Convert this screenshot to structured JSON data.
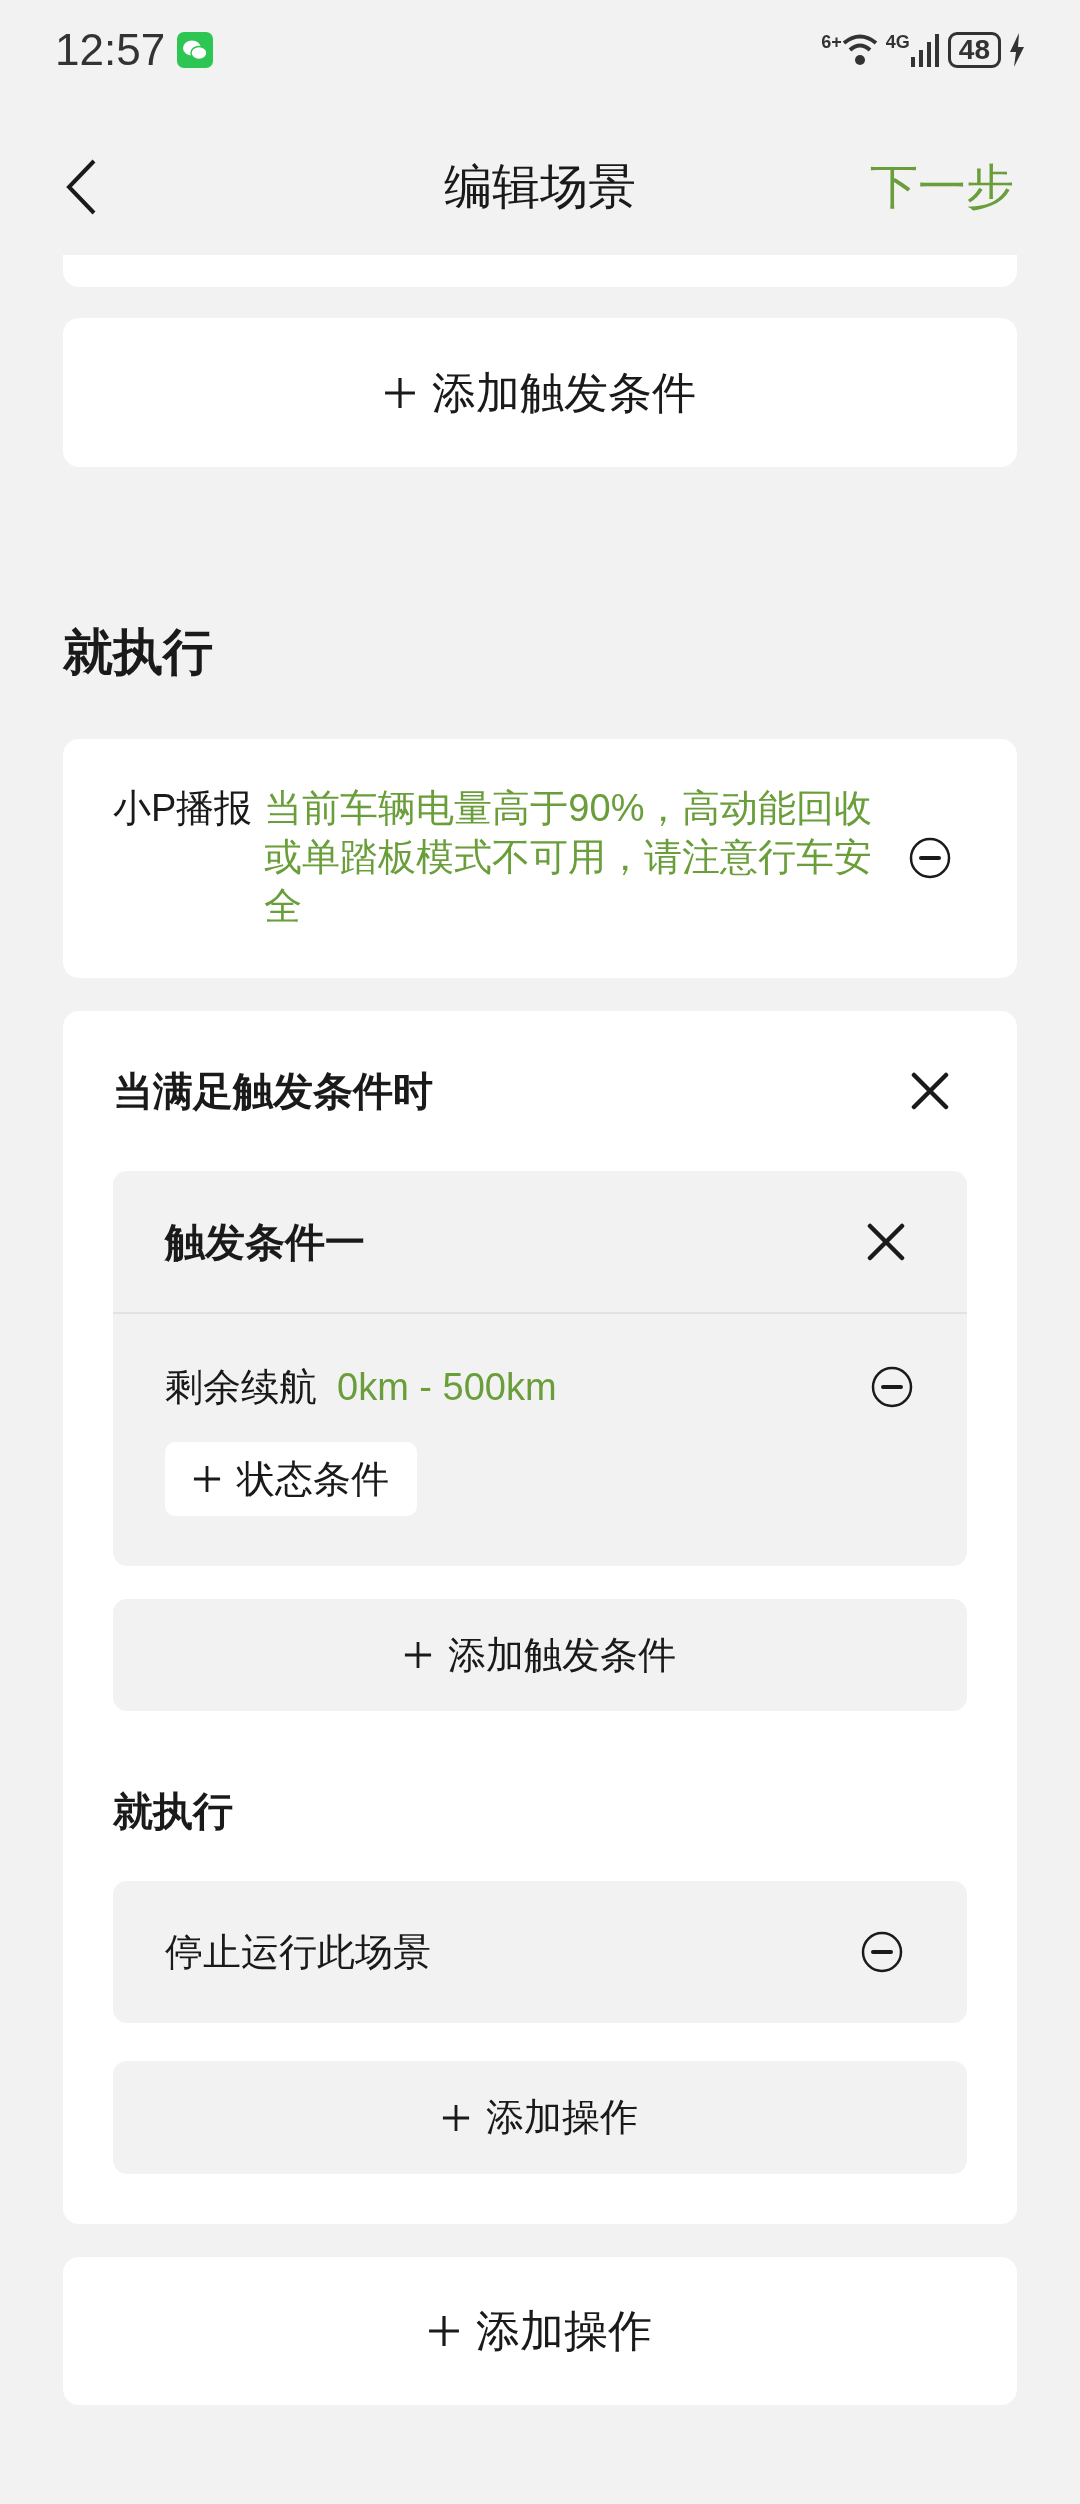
{
  "status_bar": {
    "time": "12:57",
    "wifi_label": "6+",
    "network": "4G",
    "battery": "48"
  },
  "header": {
    "title": "编辑场景",
    "action": "下一步"
  },
  "trigger_section": {
    "add_button": "添加触发条件"
  },
  "execute_section": {
    "heading": "就执行",
    "actions": [
      {
        "kind": "broadcast",
        "label": "小P播报",
        "value": "当前车辆电量高于90%，高动能回收或单踏板模式不可用，请注意行车安全"
      },
      {
        "kind": "conditional",
        "title": "当满足触发条件时",
        "conditions": [
          {
            "title": "触发条件一",
            "items": [
              {
                "label": "剩余续航",
                "value": "0km - 500km"
              }
            ],
            "add_state_button": "状态条件"
          }
        ],
        "add_condition_button": "添加触发条件",
        "then_heading": "就执行",
        "then_actions": [
          {
            "label": "停止运行此场景"
          }
        ],
        "add_action_button": "添加操作"
      }
    ],
    "add_button": "添加操作"
  }
}
